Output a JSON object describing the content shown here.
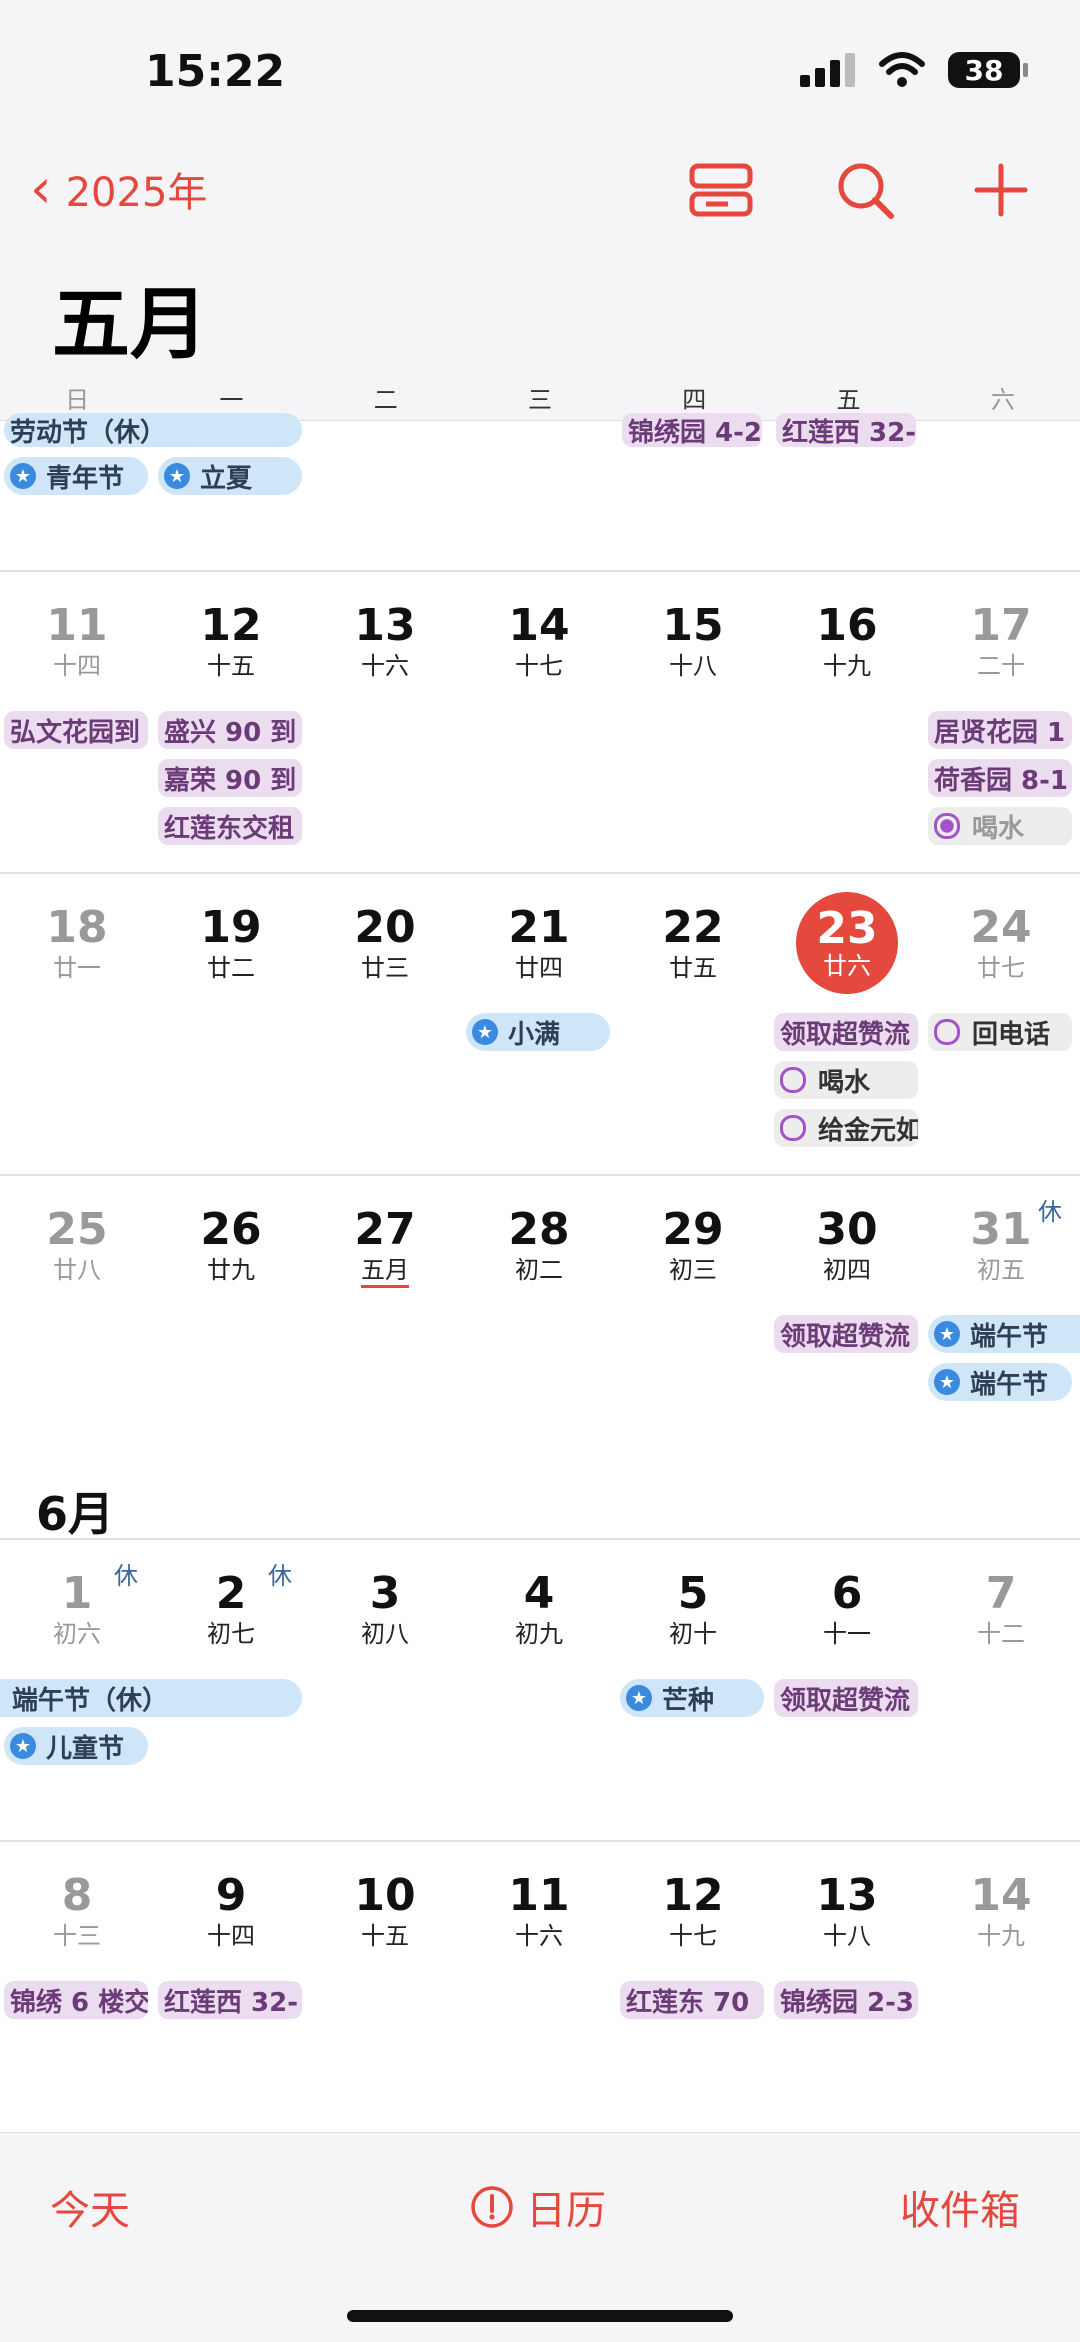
{
  "status": {
    "time": "15:22",
    "battery": "38"
  },
  "nav": {
    "back_label": "2025年"
  },
  "month_title": "五月",
  "weekdays": [
    "日",
    "一",
    "二",
    "三",
    "四",
    "五",
    "六"
  ],
  "partial_row": {
    "chips": [
      "劳动节（休）",
      "青年节",
      "立夏",
      "锦绣园 4-2",
      "红莲西 32-"
    ]
  },
  "week1": {
    "days": [
      {
        "num": "11",
        "lunar": "十四"
      },
      {
        "num": "12",
        "lunar": "十五"
      },
      {
        "num": "13",
        "lunar": "十六"
      },
      {
        "num": "14",
        "lunar": "十七"
      },
      {
        "num": "15",
        "lunar": "十八"
      },
      {
        "num": "16",
        "lunar": "十九"
      },
      {
        "num": "17",
        "lunar": "二十"
      }
    ],
    "chips": [
      "弘文花园到",
      "盛兴 90 到",
      "嘉荣 90 到",
      "红莲东交租",
      "居贤花园 1",
      "荷香园 8-1",
      "喝水"
    ]
  },
  "week2": {
    "days": [
      {
        "num": "18",
        "lunar": "廿一"
      },
      {
        "num": "19",
        "lunar": "廿二"
      },
      {
        "num": "20",
        "lunar": "廿三"
      },
      {
        "num": "21",
        "lunar": "廿四"
      },
      {
        "num": "22",
        "lunar": "廿五"
      },
      {
        "num": "23",
        "lunar": "廿六"
      },
      {
        "num": "24",
        "lunar": "廿七"
      }
    ],
    "chips": [
      "小满",
      "领取超赞流",
      "喝水",
      "给金元如",
      "回电话"
    ]
  },
  "week3": {
    "days": [
      {
        "num": "25",
        "lunar": "廿八"
      },
      {
        "num": "26",
        "lunar": "廿九"
      },
      {
        "num": "27",
        "lunar": "五月"
      },
      {
        "num": "28",
        "lunar": "初二"
      },
      {
        "num": "29",
        "lunar": "初三"
      },
      {
        "num": "30",
        "lunar": "初四"
      },
      {
        "num": "31",
        "lunar": "初五"
      }
    ],
    "rest_label": "休",
    "chips": [
      "领取超赞流",
      "端午节",
      "端午节"
    ]
  },
  "june_title": "6月",
  "week4": {
    "days": [
      {
        "num": "1",
        "lunar": "初六"
      },
      {
        "num": "2",
        "lunar": "初七"
      },
      {
        "num": "3",
        "lunar": "初八"
      },
      {
        "num": "4",
        "lunar": "初九"
      },
      {
        "num": "5",
        "lunar": "初十"
      },
      {
        "num": "6",
        "lunar": "十一"
      },
      {
        "num": "7",
        "lunar": "十二"
      }
    ],
    "rest_label": "休",
    "chips": [
      "端午节（休）",
      "儿童节",
      "芒种",
      "领取超赞流"
    ]
  },
  "week5": {
    "days": [
      {
        "num": "8",
        "lunar": "十三"
      },
      {
        "num": "9",
        "lunar": "十四"
      },
      {
        "num": "10",
        "lunar": "十五"
      },
      {
        "num": "11",
        "lunar": "十六"
      },
      {
        "num": "12",
        "lunar": "十七"
      },
      {
        "num": "13",
        "lunar": "十八"
      },
      {
        "num": "14",
        "lunar": "十九"
      }
    ],
    "chips": [
      "锦绣 6 楼交",
      "红莲西 32-",
      "红莲东 70",
      "锦绣园 2-3"
    ]
  },
  "toolbar": {
    "today": "今天",
    "calendars": "日历",
    "inbox": "收件箱"
  },
  "colors": {
    "accent": "#e5483c",
    "event_purple": "#ecdcf0",
    "holiday_blue": "#cfe6f8"
  },
  "icons": [
    "chevron-left-icon",
    "day-view-icon",
    "search-icon",
    "plus-icon",
    "alert-circle-icon",
    "signal-icon",
    "wifi-icon",
    "battery-icon",
    "star-icon"
  ]
}
